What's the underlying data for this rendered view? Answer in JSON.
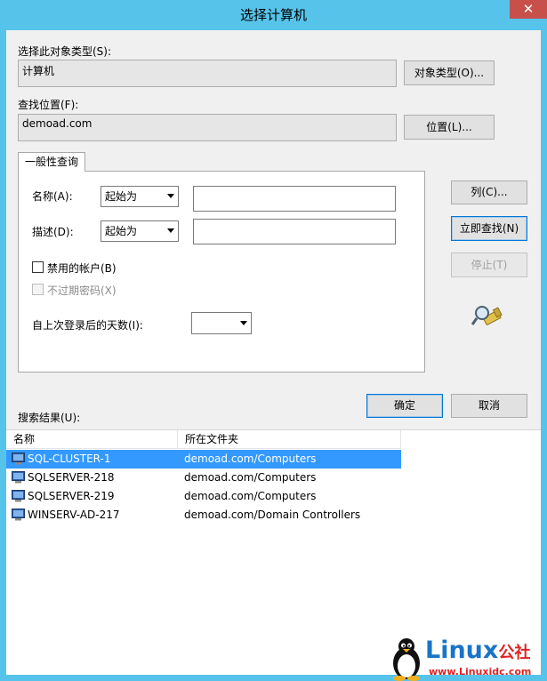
{
  "window": {
    "title": "选择计算机",
    "close_glyph": "✕"
  },
  "object_type": {
    "label": "选择此对象类型(S):",
    "value": "计算机",
    "button": "对象类型(O)..."
  },
  "location": {
    "label": "查找位置(F):",
    "value": "demoad.com",
    "button": "位置(L)..."
  },
  "query_tab": {
    "tab_label": "一般性查询",
    "name": {
      "label": "名称(A):",
      "mode": "起始为",
      "value": ""
    },
    "description": {
      "label": "描述(D):",
      "mode": "起始为",
      "value": ""
    },
    "disabled_accounts": {
      "label": "禁用的帐户(B)",
      "checked": false
    },
    "non_expiring_pwd": {
      "label": "不过期密码(X)",
      "checked": false
    },
    "days_since_login": {
      "label": "自上次登录后的天数(I):",
      "value": ""
    }
  },
  "side_buttons": {
    "columns": "列(C)...",
    "find_now": "立即查找(N)",
    "stop": "停止(T)",
    "search_icon": "search-flashlight-icon"
  },
  "footer_buttons": {
    "ok": "确定",
    "cancel": "取消"
  },
  "results": {
    "label": "搜索结果(U):",
    "columns": [
      "名称",
      "所在文件夹"
    ],
    "rows": [
      {
        "name": "SQL-CLUSTER-1",
        "folder": "demoad.com/Computers",
        "selected": true
      },
      {
        "name": "SQLSERVER-218",
        "folder": "demoad.com/Computers",
        "selected": false
      },
      {
        "name": "SQLSERVER-219",
        "folder": "demoad.com/Computers",
        "selected": false
      },
      {
        "name": "WINSERV-AD-217",
        "folder": "demoad.com/Domain Controllers",
        "selected": false
      }
    ],
    "row_icon": "computer-icon"
  },
  "watermark": {
    "brand": "Linux",
    "suffix": "公社",
    "url": "www.Linuxidc.com"
  },
  "colors": {
    "titlebar": "#56c4ea",
    "selection": "#3399ff",
    "close": "#c7504b"
  }
}
